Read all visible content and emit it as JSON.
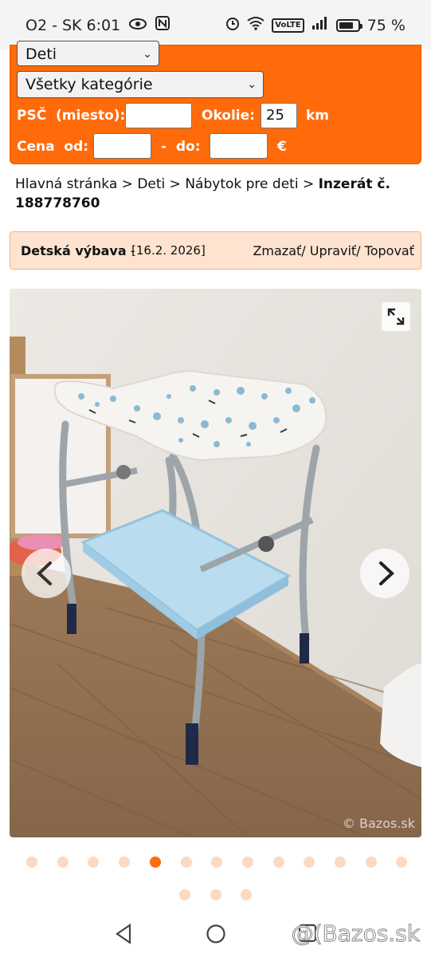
{
  "status_bar": {
    "carrier": "O2 - SK",
    "time": "6:01",
    "battery_percent": "75 %",
    "volte": "VoLTE",
    "battery_level": 0.75
  },
  "search": {
    "section_value": "Deti",
    "category_value": "Všetky kategórie",
    "psc_label": "PSČ  (miesto):",
    "psc_value": "",
    "okolie_label": "Okolie:",
    "okolie_value": "25",
    "km_label": "km",
    "cena_label": "Cena  od:",
    "cena_od_value": "",
    "dash_label": "-  do:",
    "cena_do_value": "",
    "currency": "€"
  },
  "breadcrumb": {
    "home": "Hlavná stránka",
    "sep": " > ",
    "category": "Deti",
    "subcategory": "Nábytok pre deti",
    "current": "Inzerát č. 188778760"
  },
  "ad": {
    "title": "Detská výbava",
    "title_sep": " - ",
    "date": "[16.2. 2026]",
    "actions": "Zmazať/ Upraviť/ Topovať"
  },
  "gallery": {
    "watermark": "© Bazos.sk",
    "total_images": 16,
    "active_index": 4
  },
  "navbar": {
    "watermark": "@(Bazos.sk"
  },
  "colors": {
    "accent": "#ff6b0b",
    "ad_bar": "#fde3d0",
    "dot_inactive": "#fcd9c0"
  }
}
